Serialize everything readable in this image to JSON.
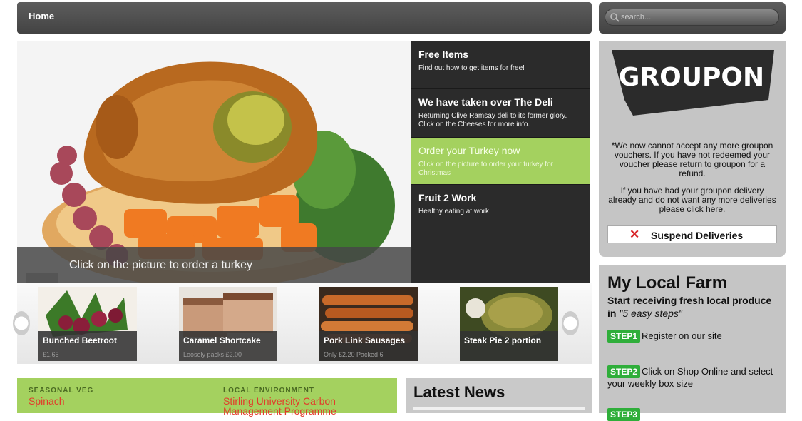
{
  "nav": {
    "home_label": "Home"
  },
  "search": {
    "placeholder": "search..."
  },
  "hero": {
    "caption": "Click on the picture to order a turkey"
  },
  "side_menu": [
    {
      "title": "Free Items",
      "desc": "Find out how to get items for free!"
    },
    {
      "title": "We have taken over The Deli",
      "desc": "Returning Clive Ramsay deli to its former glory. Click on the Cheeses for more info."
    },
    {
      "title": "Order your Turkey now",
      "desc": "Click on the picture to order your turkey for Christmas"
    },
    {
      "title": "Fruit 2 Work",
      "desc": "Healthy eating at work"
    }
  ],
  "carousel": [
    {
      "name": "Bunched Beetroot",
      "sub": "£1.65"
    },
    {
      "name": "Caramel Shortcake",
      "sub": "Loosely packs £2.00"
    },
    {
      "name": "Pork Link Sausages",
      "sub": "Only £2.20 Packed 6"
    },
    {
      "name": "Steak Pie 2 portion",
      "sub": ""
    }
  ],
  "features": [
    {
      "kicker": "SEASONAL VEG",
      "title": "Spinach"
    },
    {
      "kicker": "LOCAL ENVIRONMENT",
      "title": "Stirling University Carbon Management Programme"
    }
  ],
  "news": {
    "heading": "Latest News"
  },
  "groupon": {
    "logo_text": "GROUPON",
    "notice": "*We now cannot accept any more groupon vouchers. If you have not redeemed your voucher please return to groupon for a refund.",
    "delivered": "If you have had your groupon delivery already and do not want any more deliveries please click here.",
    "suspend_label": "Suspend Deliveries"
  },
  "farm": {
    "heading": "My Local Farm",
    "intro": "Start receiving fresh local produce in",
    "intro_link": "\"5 easy steps\"",
    "steps": [
      {
        "badge": "STEP1",
        "text": "Register on our site"
      },
      {
        "badge": "STEP2",
        "text": "Click on Shop Online and select your weekly box size"
      },
      {
        "badge": "STEP3",
        "text": ""
      }
    ]
  },
  "colors": {
    "accent_green": "#a4d15f",
    "nav_dark": "#4f4f4f",
    "panel_gray": "#c5c5c5",
    "step_green": "#2fae3a",
    "link_red": "#e23c2a"
  }
}
